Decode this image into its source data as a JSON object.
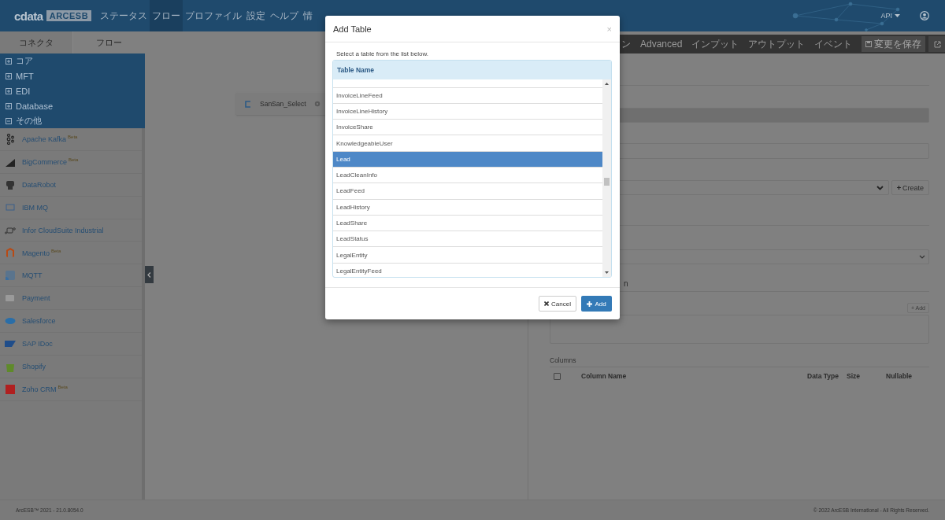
{
  "header": {
    "logo": {
      "brand": "cdata",
      "product": "ARCESB"
    },
    "nav": [
      {
        "label": "ステータス",
        "selected": false
      },
      {
        "label": "フロー",
        "selected": true
      },
      {
        "label": "プロファイル",
        "selected": false
      },
      {
        "label": "設定",
        "selected": false
      },
      {
        "label": "ヘルプ",
        "selected": false
      },
      {
        "label": "情",
        "selected": false
      }
    ],
    "api_menu": "API"
  },
  "sidebar": {
    "tabs": [
      {
        "label": "コネクタ",
        "selected": true
      },
      {
        "label": "フロー",
        "selected": false
      }
    ],
    "categories": [
      {
        "label": "コア",
        "expanded": false
      },
      {
        "label": "MFT",
        "expanded": false
      },
      {
        "label": "EDI",
        "expanded": false
      },
      {
        "label": "Database",
        "expanded": false
      },
      {
        "label": "その他",
        "expanded": true
      }
    ],
    "connectors": [
      {
        "name": "Apache Kafka",
        "badge": "Beta"
      },
      {
        "name": "BigCommerce",
        "badge": "Beta"
      },
      {
        "name": "DataRobot"
      },
      {
        "name": "IBM MQ"
      },
      {
        "name": "Infor CloudSuite Industrial"
      },
      {
        "name": "Magento",
        "badge": "Beta"
      },
      {
        "name": "MQTT"
      },
      {
        "name": "Payment"
      },
      {
        "name": "Salesforce"
      },
      {
        "name": "SAP IDoc"
      },
      {
        "name": "Shopify"
      },
      {
        "name": "Zoho CRM",
        "badge": "Beta"
      }
    ]
  },
  "canvas": {
    "nodes": [
      {
        "label": "SanSan_Select"
      }
    ]
  },
  "panel": {
    "tabs": [
      "ン",
      "Advanced",
      "インプット",
      "アウトプット",
      "イベント"
    ],
    "save_button": "変更を保存",
    "create_button": "Create",
    "section_heading": "n",
    "add_button": "+ Add",
    "columns_heading": "Columns",
    "table_columns": [
      {
        "label": "Column Name",
        "kind": "name"
      },
      {
        "label": "Data Type",
        "kind": "type"
      },
      {
        "label": "Size",
        "kind": "size"
      },
      {
        "label": "Nullable",
        "kind": "nullable"
      }
    ],
    "select_all": {
      "checked": false
    }
  },
  "modal": {
    "title": "Add Table",
    "close": "×",
    "instruction": "Select a table from the list below.",
    "column": "Table Name",
    "rows": [
      {
        "name": "InvoiceLineFeed",
        "selected": false
      },
      {
        "name": "InvoiceLineHistory",
        "selected": false
      },
      {
        "name": "InvoiceShare",
        "selected": false
      },
      {
        "name": "KnowledgeableUser",
        "selected": false
      },
      {
        "name": "Lead",
        "selected": true
      },
      {
        "name": "LeadCleanInfo",
        "selected": false
      },
      {
        "name": "LeadFeed",
        "selected": false
      },
      {
        "name": "LeadHistory",
        "selected": false
      },
      {
        "name": "LeadShare",
        "selected": false
      },
      {
        "name": "LeadStatus",
        "selected": false
      },
      {
        "name": "LegalEntity",
        "selected": false
      },
      {
        "name": "LegalEntityFeed",
        "selected": false
      }
    ],
    "cancel": "Cancel",
    "add": "Add"
  },
  "footer": {
    "left": "ArcESB™ 2021 - 21.0.8054.0",
    "right": "© 2022 ArcESB International - All Rights Reserved."
  }
}
